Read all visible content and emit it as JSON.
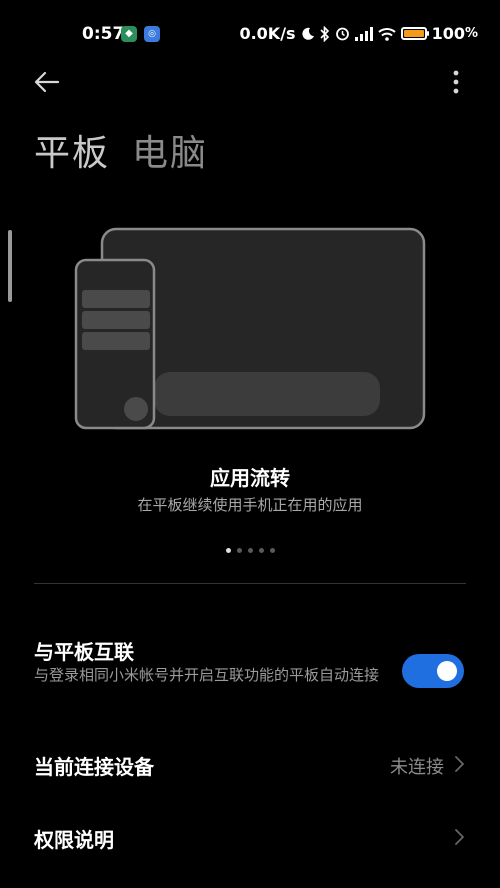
{
  "status_bar": {
    "time": "0:57",
    "network_speed": "0.0K/s",
    "battery": "100",
    "battery_suffix": "%",
    "icons": [
      "shield-app-icon",
      "app-icon",
      "moon-icon",
      "bluetooth-icon",
      "alarm-icon",
      "signal-icon",
      "wifi-icon",
      "battery-icon"
    ]
  },
  "header": {
    "tabs": [
      {
        "label": "平板",
        "active": true
      },
      {
        "label": "电脑",
        "active": false
      }
    ]
  },
  "feature": {
    "title": "应用流转",
    "description": "在平板继续使用手机正在用的应用",
    "page_count": 5,
    "current_page": 1
  },
  "settings": {
    "interconnect": {
      "title": "与平板互联",
      "description": "与登录相同小米帐号并开启互联功能的平板自动连接",
      "enabled": true
    },
    "current_device": {
      "title": "当前连接设备",
      "value": "未连接"
    },
    "permissions": {
      "title": "权限说明"
    }
  },
  "colors": {
    "background": "#000000",
    "toggle_on": "#1f6fe0",
    "battery_fill": "#f39a1a"
  }
}
